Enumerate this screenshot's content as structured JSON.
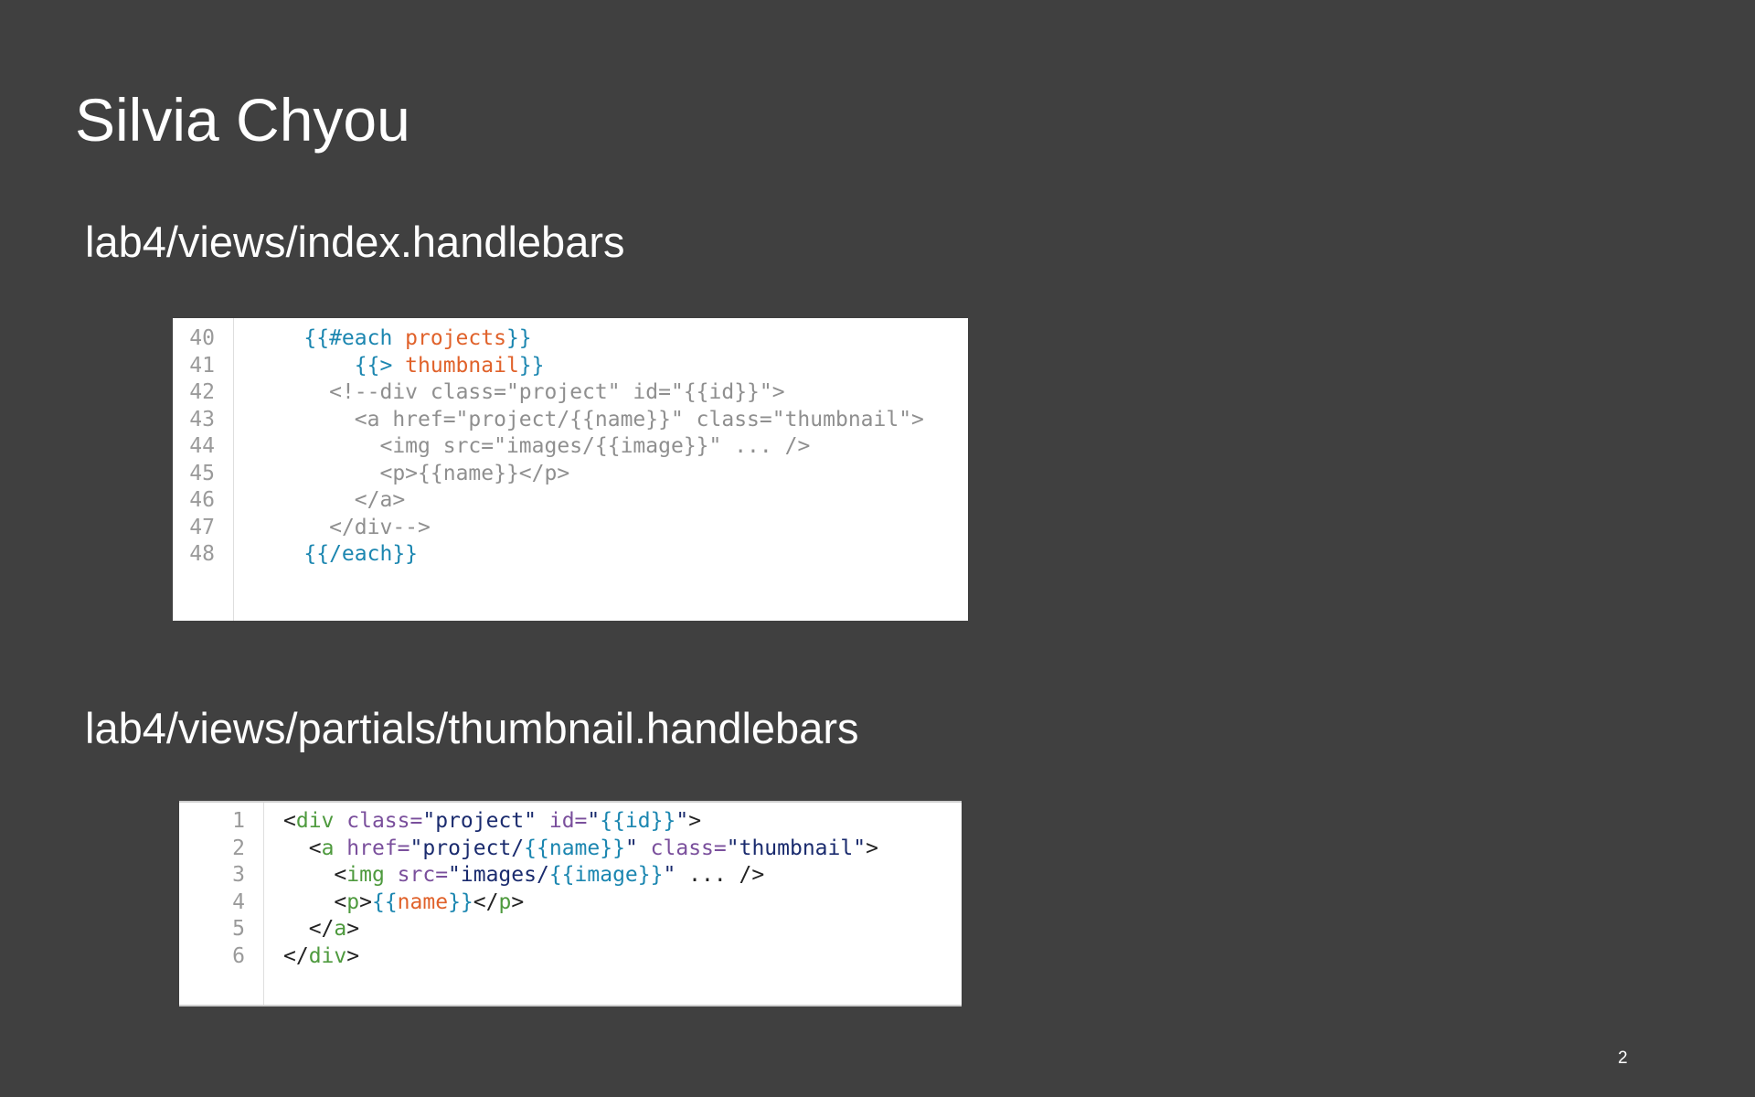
{
  "slide": {
    "title": "Silvia Chyou",
    "page_number": "2"
  },
  "section1": {
    "label": "lab4/views/index.handlebars",
    "lines": [
      {
        "num": "40",
        "indent": "    ",
        "segments": [
          {
            "t": "{{#each ",
            "c": "hb"
          },
          {
            "t": "projects",
            "c": "var"
          },
          {
            "t": "}}",
            "c": "hb"
          }
        ]
      },
      {
        "num": "41",
        "indent": "        ",
        "segments": [
          {
            "t": "{{> ",
            "c": "hb"
          },
          {
            "t": "thumbnail",
            "c": "var"
          },
          {
            "t": "}}",
            "c": "hb"
          }
        ]
      },
      {
        "num": "42",
        "indent": "      ",
        "segments": [
          {
            "t": "<!--div class=\"project\" id=\"{{id}}\">",
            "c": "cm"
          }
        ]
      },
      {
        "num": "43",
        "indent": "        ",
        "segments": [
          {
            "t": "<a href=\"project/{{name}}\" class=\"thumbnail\">",
            "c": "cm"
          }
        ]
      },
      {
        "num": "44",
        "indent": "          ",
        "segments": [
          {
            "t": "<img src=\"images/{{image}}\" ... />",
            "c": "cm"
          }
        ]
      },
      {
        "num": "45",
        "indent": "          ",
        "segments": [
          {
            "t": "<p>{{name}}</p>",
            "c": "cm"
          }
        ]
      },
      {
        "num": "46",
        "indent": "        ",
        "segments": [
          {
            "t": "</a>",
            "c": "cm"
          }
        ]
      },
      {
        "num": "47",
        "indent": "      ",
        "segments": [
          {
            "t": "</div-->",
            "c": "cm"
          }
        ]
      },
      {
        "num": "48",
        "indent": "    ",
        "segments": [
          {
            "t": "{{/each}}",
            "c": "hb"
          }
        ]
      }
    ]
  },
  "section2": {
    "label": "lab4/views/partials/thumbnail.handlebars",
    "lines": [
      {
        "num": "1",
        "indent": "",
        "segments": [
          {
            "t": "<",
            "c": "pl"
          },
          {
            "t": "div",
            "c": "tag"
          },
          {
            "t": " ",
            "c": "pl"
          },
          {
            "t": "class=",
            "c": "attr"
          },
          {
            "t": "\"project\"",
            "c": "str"
          },
          {
            "t": " ",
            "c": "pl"
          },
          {
            "t": "id=",
            "c": "attr"
          },
          {
            "t": "\"",
            "c": "str"
          },
          {
            "t": "{{id}}",
            "c": "hb"
          },
          {
            "t": "\"",
            "c": "str"
          },
          {
            "t": ">",
            "c": "pl"
          }
        ]
      },
      {
        "num": "2",
        "indent": "  ",
        "segments": [
          {
            "t": "<",
            "c": "pl"
          },
          {
            "t": "a",
            "c": "tag"
          },
          {
            "t": " ",
            "c": "pl"
          },
          {
            "t": "href=",
            "c": "attr"
          },
          {
            "t": "\"project/",
            "c": "str"
          },
          {
            "t": "{{name}}",
            "c": "hb"
          },
          {
            "t": "\"",
            "c": "str"
          },
          {
            "t": " ",
            "c": "pl"
          },
          {
            "t": "class=",
            "c": "attr"
          },
          {
            "t": "\"thumbnail\"",
            "c": "str"
          },
          {
            "t": ">",
            "c": "pl"
          }
        ]
      },
      {
        "num": "3",
        "indent": "    ",
        "segments": [
          {
            "t": "<",
            "c": "pl"
          },
          {
            "t": "img",
            "c": "tag"
          },
          {
            "t": " ",
            "c": "pl"
          },
          {
            "t": "src=",
            "c": "attr"
          },
          {
            "t": "\"images/",
            "c": "str"
          },
          {
            "t": "{{image}}",
            "c": "hb"
          },
          {
            "t": "\"",
            "c": "str"
          },
          {
            "t": " ... />",
            "c": "pl"
          }
        ]
      },
      {
        "num": "4",
        "indent": "    ",
        "segments": [
          {
            "t": "<",
            "c": "pl"
          },
          {
            "t": "p",
            "c": "tag"
          },
          {
            "t": ">",
            "c": "pl"
          },
          {
            "t": "{{",
            "c": "hb"
          },
          {
            "t": "name",
            "c": "var"
          },
          {
            "t": "}}",
            "c": "hb"
          },
          {
            "t": "</",
            "c": "pl"
          },
          {
            "t": "p",
            "c": "tag"
          },
          {
            "t": ">",
            "c": "pl"
          }
        ]
      },
      {
        "num": "5",
        "indent": "  ",
        "segments": [
          {
            "t": "</",
            "c": "pl"
          },
          {
            "t": "a",
            "c": "tag"
          },
          {
            "t": ">",
            "c": "pl"
          }
        ]
      },
      {
        "num": "6",
        "indent": "",
        "segments": [
          {
            "t": "</",
            "c": "pl"
          },
          {
            "t": "div",
            "c": "tag"
          },
          {
            "t": ">",
            "c": "pl"
          }
        ]
      }
    ]
  },
  "colors": {
    "background": "#404040",
    "handlebars": "#1b86b0",
    "variable": "#e0622b",
    "comment": "#8f8f8f",
    "tag": "#4e9a3e",
    "attribute": "#7a4f9c",
    "string": "#1a2b6e"
  }
}
